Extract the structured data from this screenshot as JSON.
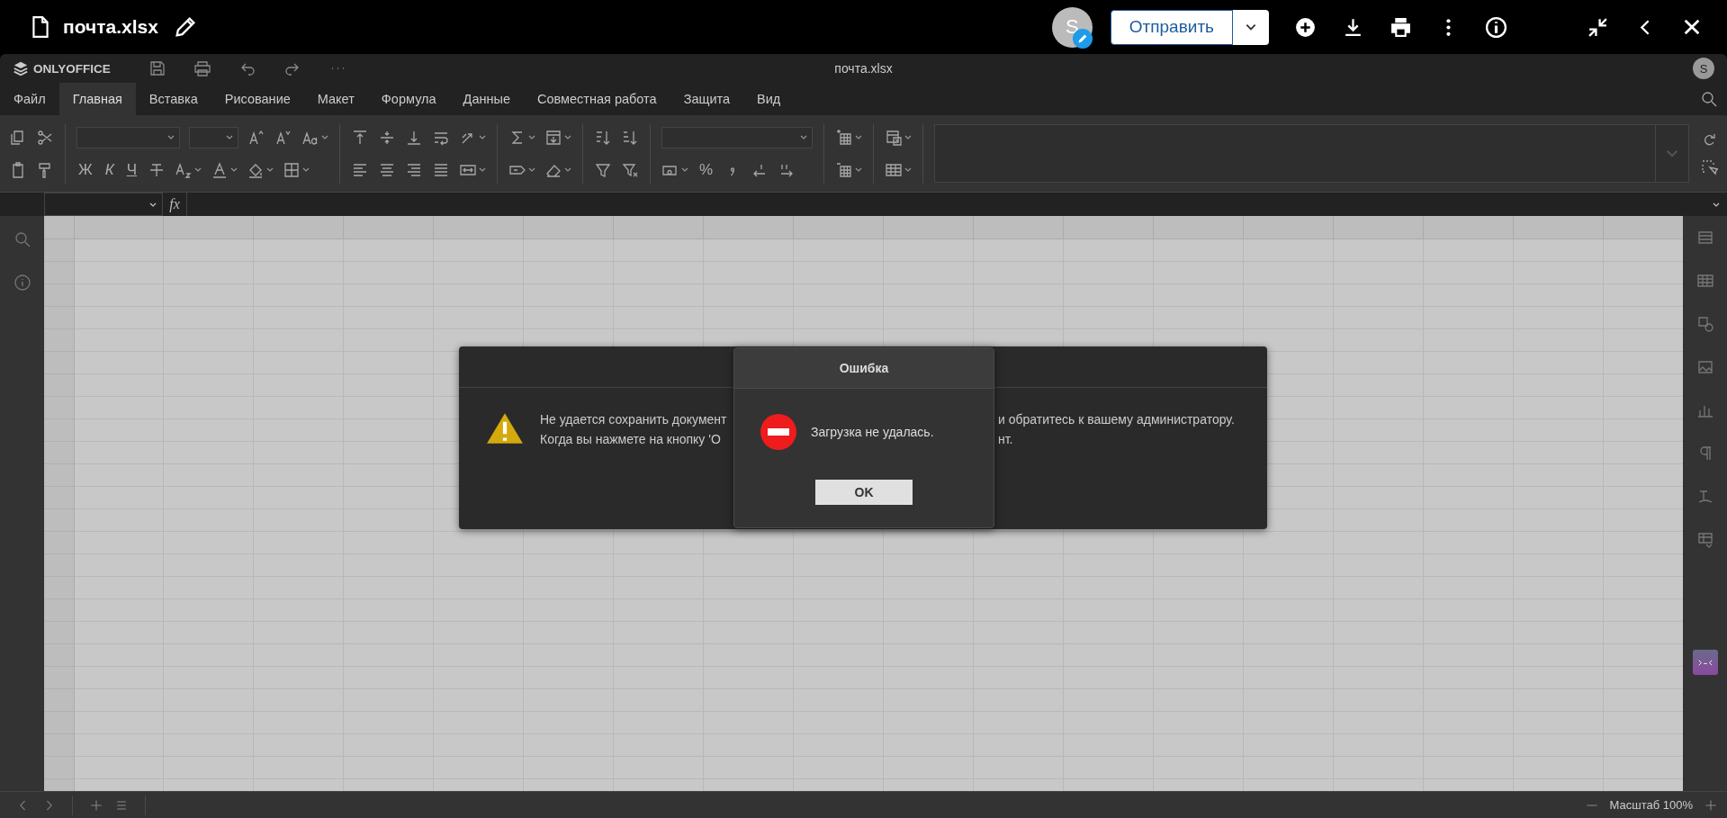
{
  "top_bar": {
    "file_name": "почта.xlsx",
    "avatar": "S",
    "send_button": "Отправить"
  },
  "editor": {
    "logo": "ONLYOFFICE",
    "title": "почта.xlsx",
    "user_avatar": "S"
  },
  "tabs": [
    {
      "label": "Файл",
      "selected": false
    },
    {
      "label": "Главная",
      "selected": true
    },
    {
      "label": "Вставка",
      "selected": false
    },
    {
      "label": "Рисование",
      "selected": false
    },
    {
      "label": "Макет",
      "selected": false
    },
    {
      "label": "Формула",
      "selected": false
    },
    {
      "label": "Данные",
      "selected": false
    },
    {
      "label": "Совместная работа",
      "selected": false
    },
    {
      "label": "Защита",
      "selected": false
    },
    {
      "label": "Вид",
      "selected": false
    }
  ],
  "toolbar": {
    "font_style_buttons": [
      "Ж",
      "К",
      "Ч"
    ],
    "percent_button": "%"
  },
  "formula_bar": {
    "function_label": "fx"
  },
  "warning_dialog": {
    "lines": [
      {
        "start": "Не удается сохранить документ",
        "end": "и обратитесь к вашему администратору."
      },
      {
        "start": "Когда вы нажмете на кнопку 'О",
        "end": "нт."
      }
    ]
  },
  "error_dialog": {
    "title": "Ошибка",
    "message": "Загрузка не удалась.",
    "button": "OK"
  },
  "status_bar": {
    "zoom": "Масштаб 100%"
  }
}
